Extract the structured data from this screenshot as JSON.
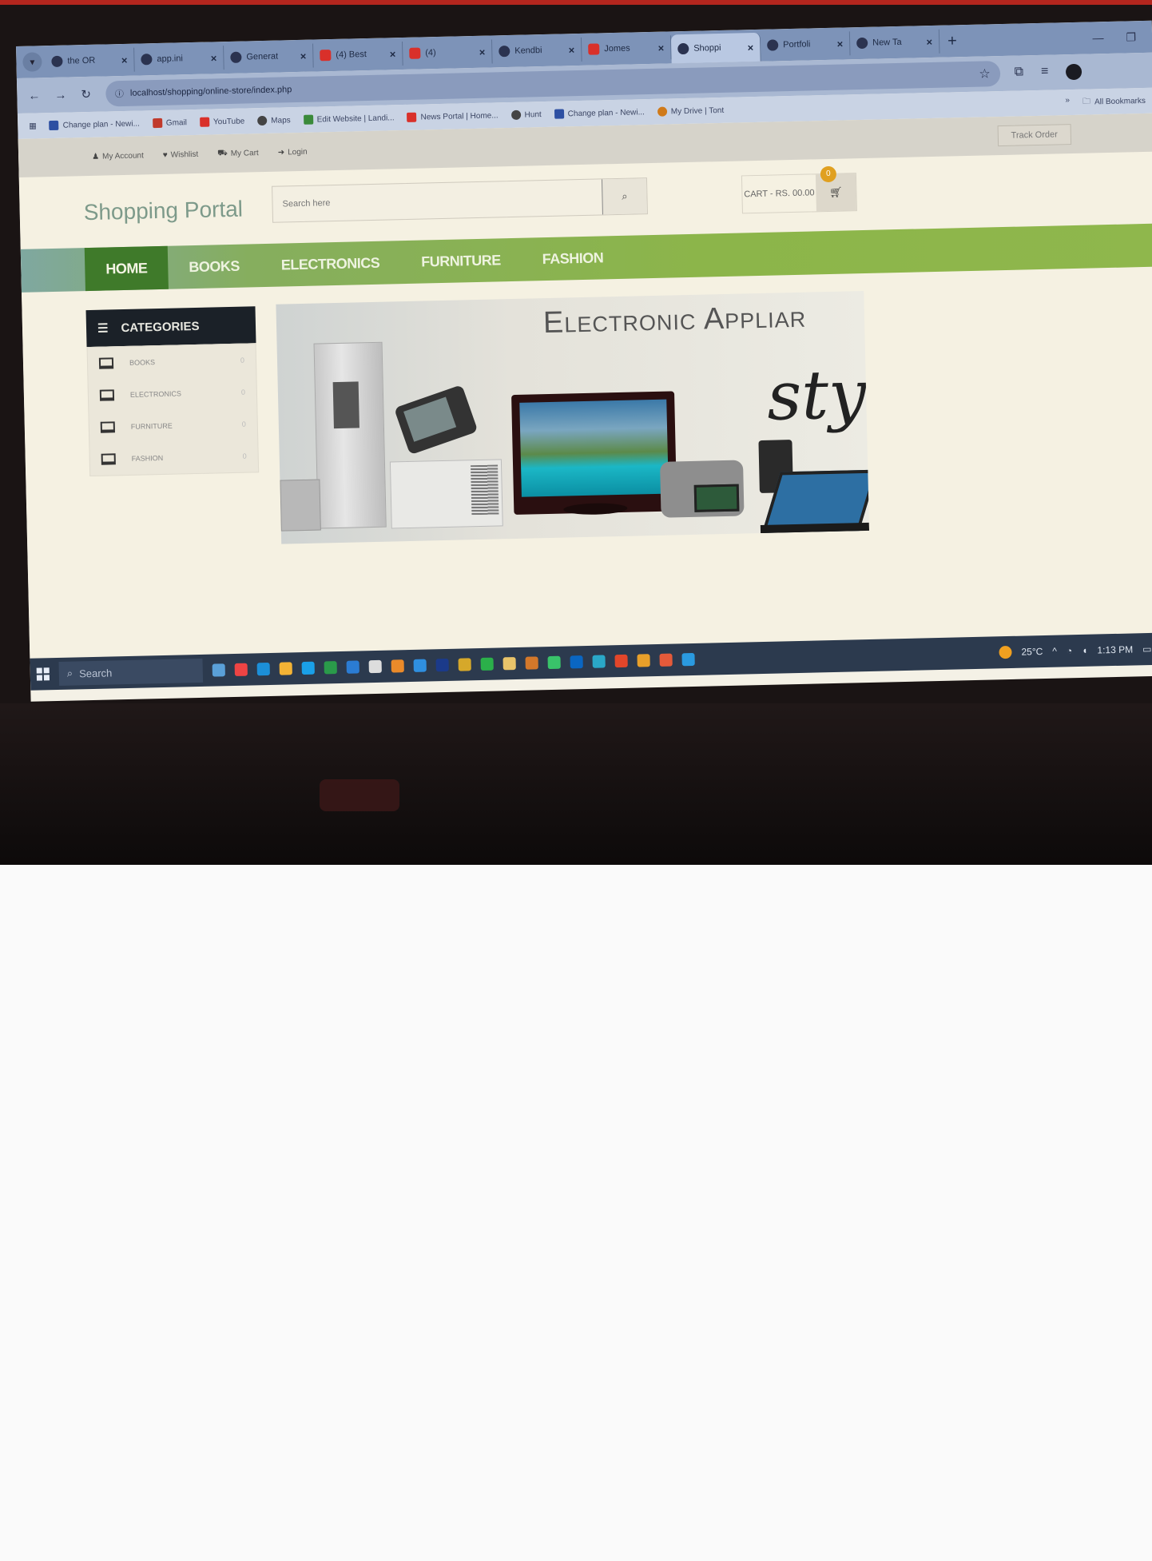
{
  "browser": {
    "tabs": [
      {
        "label": "the OR",
        "icon": "globe-icon"
      },
      {
        "label": "app.ini",
        "icon": "globe-icon"
      },
      {
        "label": "Generat",
        "icon": "globe-icon"
      },
      {
        "label": "(4) Best",
        "icon": "youtube-icon"
      },
      {
        "label": "(4) ",
        "icon": "youtube-icon"
      },
      {
        "label": "Kendbi",
        "icon": "github-icon"
      },
      {
        "label": "Jomes",
        "icon": "news-icon"
      },
      {
        "label": "Shoppi",
        "icon": "shop-icon",
        "active": true
      },
      {
        "label": "Portfoli",
        "icon": "globe-icon"
      },
      {
        "label": "New Ta",
        "icon": "globe-icon"
      }
    ],
    "new_tab": "+",
    "url": "localhost/shopping/online-store/index.php",
    "bookmarks": [
      {
        "label": "Change plan - Newi...",
        "icon": "facebook-icon"
      },
      {
        "label": "Gmail",
        "icon": "gmail-icon"
      },
      {
        "label": "YouTube",
        "icon": "youtube-icon"
      },
      {
        "label": "Maps",
        "icon": "maps-icon"
      },
      {
        "label": "Edit Website | Landi...",
        "icon": "landing-icon"
      },
      {
        "label": "News Portal | Home...",
        "icon": "news-icon"
      },
      {
        "label": "Hunt",
        "icon": "hunt-icon"
      },
      {
        "label": "Change plan - Newi...",
        "icon": "facebook-icon"
      },
      {
        "label": "My Drive | Tont",
        "icon": "drive-icon"
      }
    ],
    "all_bookmarks": "All Bookmarks"
  },
  "site": {
    "topbar": {
      "my_account": "My Account",
      "wishlist": "Wishlist",
      "my_cart": "My Cart",
      "login": "Login",
      "track_order": "Track Order"
    },
    "logo": "Shopping Portal",
    "search_placeholder": "Search here",
    "cart": {
      "text": "CART - RS. 00.00",
      "count": "0"
    },
    "nav": [
      "HOME",
      "BOOKS",
      "ELECTRONICS",
      "FURNITURE",
      "FASHION"
    ],
    "categories": {
      "title": "CATEGORIES",
      "items": [
        {
          "label": "BOOKS",
          "count": "0"
        },
        {
          "label": "ELECTRONICS",
          "count": "0"
        },
        {
          "label": "FURNITURE",
          "count": "0"
        },
        {
          "label": "FASHION",
          "count": "0"
        }
      ]
    },
    "banner": {
      "title": "Electronic Appliar",
      "script": "sty"
    }
  },
  "taskbar": {
    "search": "Search",
    "temperature": "25°C",
    "time": "1:13 PM"
  }
}
